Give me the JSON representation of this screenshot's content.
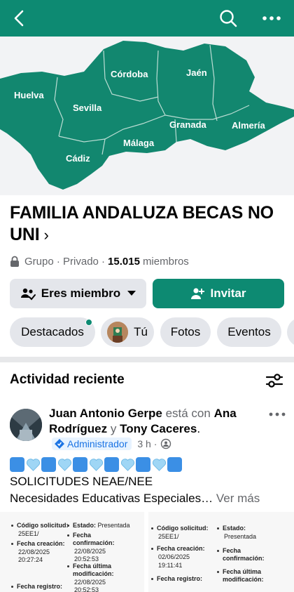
{
  "topbar": {
    "back_icon": "chevron-left-icon",
    "search_icon": "search-icon",
    "more_icon": "more-horizontal-icon",
    "color": "#0d8a72"
  },
  "cover": {
    "regions": [
      "Córdoba",
      "Jaén",
      "Huelva",
      "Sevilla",
      "Granada",
      "Almería",
      "Málaga",
      "Cádiz"
    ],
    "map_color": "#12876f"
  },
  "group": {
    "title": "FAMILIA ANDALUZA BECAS NO UNI",
    "chevron": "›",
    "type": "Grupo · Privado ·",
    "member_count": "15.015",
    "members_label": "miembros"
  },
  "actions": {
    "member_label": "Eres miembro",
    "invite_label": "Invitar"
  },
  "tabs": [
    "Destacados",
    "Tú",
    "Fotos",
    "Eventos"
  ],
  "activity": {
    "title": "Actividad reciente"
  },
  "post": {
    "author": "Juan Antonio Gerpe",
    "connector": "está con",
    "tagged1": "Ana Rodríguez",
    "and": "y",
    "tagged2": "Tony Caceres",
    "period": ".",
    "role": "Administrador",
    "time": "3 h ·",
    "line1": "SOLICITUDES NEAE/NEE",
    "line2": "Necesidades Educativas Especiales…",
    "see_more": "Ver más"
  },
  "doc_left": {
    "code_label": "Código solicitud:",
    "code_value": "25EE1/",
    "state_label": "Estado:",
    "state_value": "Presentada",
    "created_label": "Fecha creación:",
    "created_date": "22/08/2025",
    "created_time": "20:27:24",
    "confirm_label1": "Fecha",
    "confirm_label2": "confirmación:",
    "confirm_date": "22/08/2025",
    "confirm_time": "20:52:53",
    "mod_label1": "Fecha última",
    "mod_label2": "modificación:",
    "mod_date": "22/08/2025",
    "mod_time": "20:52:53",
    "reg_label": "Fecha registro:"
  },
  "doc_right": {
    "code_label": "Código solicitud:",
    "code_value": "25EE1/",
    "state_label": "Estado:",
    "state_value": "Presentada",
    "created_label": "Fecha creación:",
    "created_date": "02/06/2025",
    "created_time": "19:11:41",
    "confirm_label1": "Fecha",
    "confirm_label2": "confirmación:",
    "mod_label1": "Fecha última",
    "mod_label2": "modificación:",
    "reg_label": "Fecha registro:"
  }
}
